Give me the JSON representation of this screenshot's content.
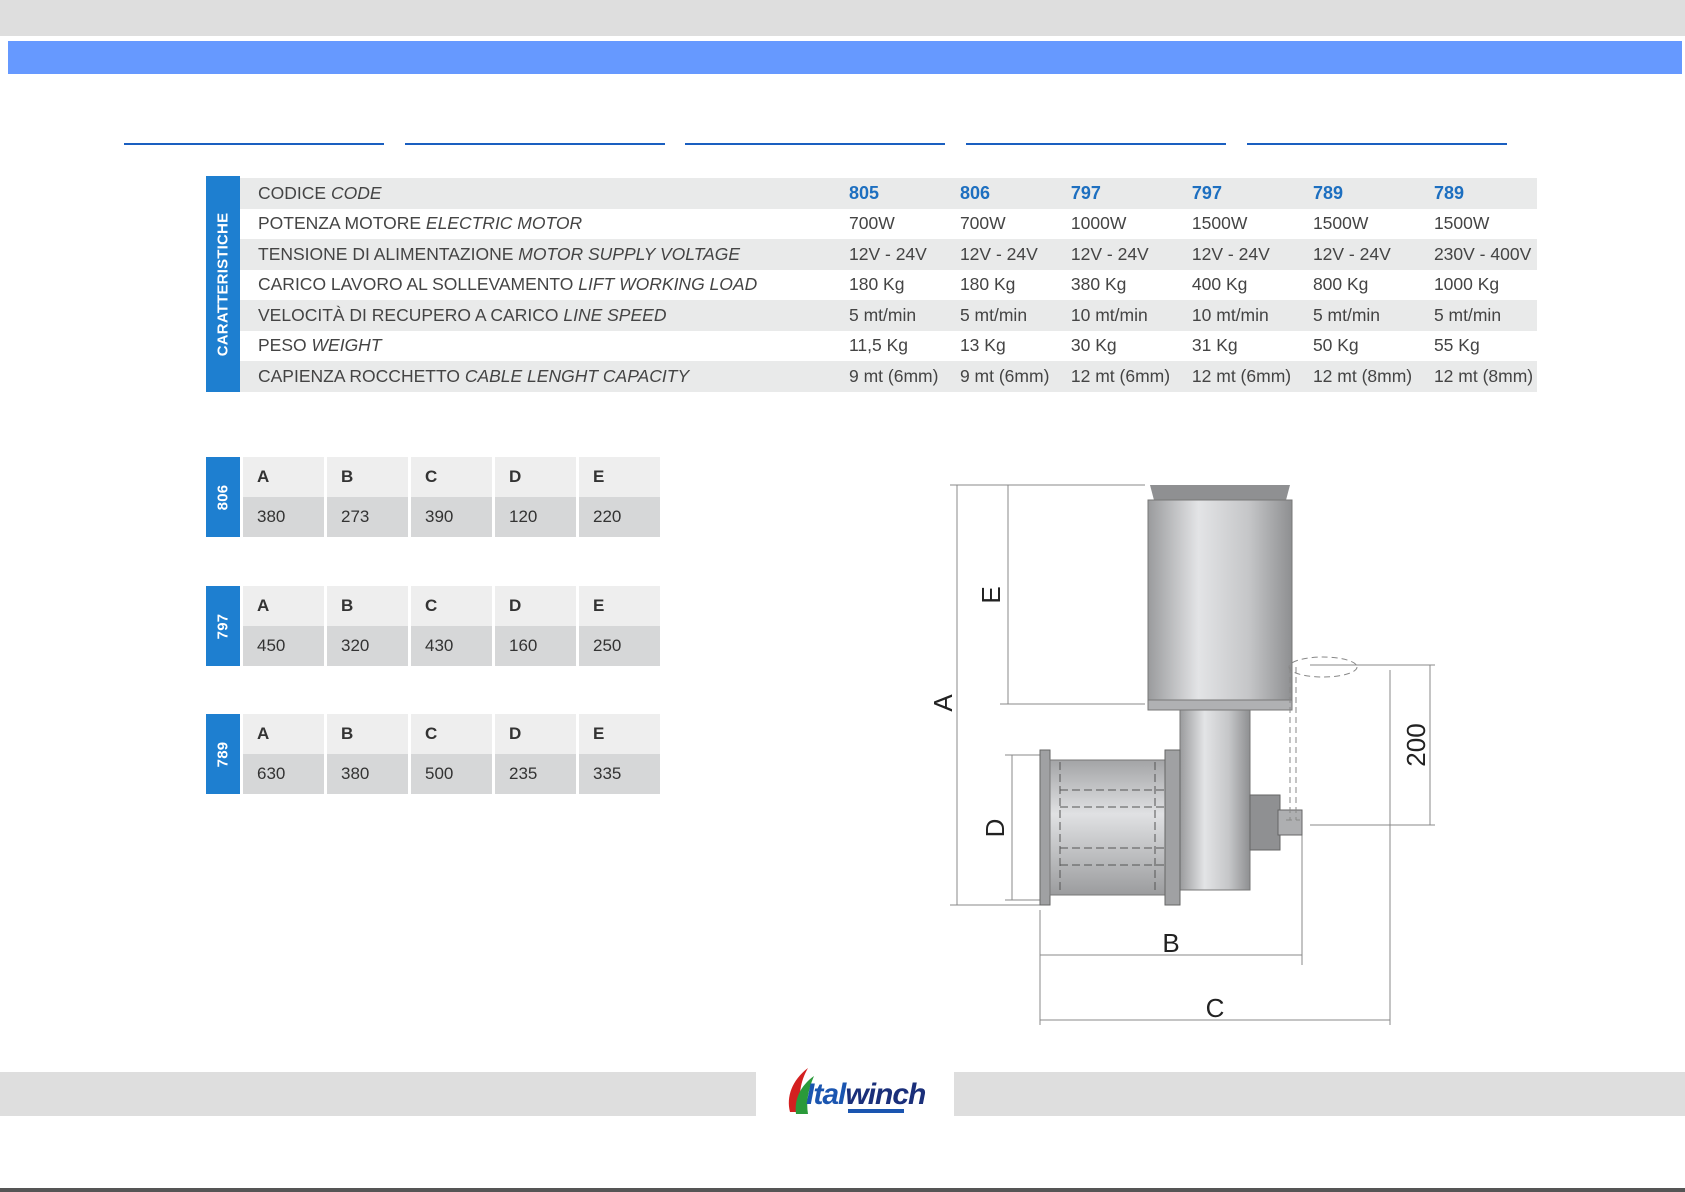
{
  "spec": {
    "side_label": "CARATTERISTICHE",
    "rows": [
      {
        "it": "CODICE",
        "en": "CODE",
        "values": [
          "805",
          "806",
          "797",
          "797",
          "789",
          "789"
        ],
        "is_code": true
      },
      {
        "it": "POTENZA MOTORE",
        "en": "ELECTRIC MOTOR",
        "values": [
          "700W",
          "700W",
          "1000W",
          "1500W",
          "1500W",
          "1500W"
        ]
      },
      {
        "it": "TENSIONE DI ALIMENTAZIONE",
        "en": "MOTOR SUPPLY VOLTAGE",
        "values": [
          "12V - 24V",
          "12V - 24V",
          "12V - 24V",
          "12V - 24V",
          "12V - 24V",
          "230V - 400V"
        ]
      },
      {
        "it": "CARICO LAVORO AL SOLLEVAMENTO",
        "en": "LIFT WORKING LOAD",
        "values": [
          "180 Kg",
          "180 Kg",
          "380 Kg",
          "400 Kg",
          "800 Kg",
          "1000 Kg"
        ]
      },
      {
        "it": "VELOCITÀ DI RECUPERO A CARICO",
        "en": "LINE SPEED",
        "values": [
          "5 mt/min",
          "5 mt/min",
          "10 mt/min",
          "10 mt/min",
          "5 mt/min",
          "5 mt/min"
        ]
      },
      {
        "it": "PESO",
        "en": "WEIGHT",
        "values": [
          "11,5 Kg",
          "13 Kg",
          "30 Kg",
          "31 Kg",
          "50 Kg",
          "55 Kg"
        ]
      },
      {
        "it": "CAPIENZA ROCCHETTO",
        "en": "CABLE LENGHT CAPACITY",
        "values": [
          "9 mt (6mm)",
          "9 mt (6mm)",
          "12 mt (6mm)",
          "12 mt (6mm)",
          "12 mt (8mm)",
          "12 mt (8mm)"
        ]
      }
    ]
  },
  "dimension_tables": [
    {
      "model": "806",
      "headers": [
        "A",
        "B",
        "C",
        "D",
        "E"
      ],
      "values": [
        "380",
        "273",
        "390",
        "120",
        "220"
      ]
    },
    {
      "model": "797",
      "headers": [
        "A",
        "B",
        "C",
        "D",
        "E"
      ],
      "values": [
        "450",
        "320",
        "430",
        "160",
        "250"
      ]
    },
    {
      "model": "789",
      "headers": [
        "A",
        "B",
        "C",
        "D",
        "E"
      ],
      "values": [
        "630",
        "380",
        "500",
        "235",
        "335"
      ]
    }
  ],
  "drawing": {
    "labels": {
      "A": "A",
      "B": "B",
      "C": "C",
      "D": "D",
      "E": "E",
      "height": "200"
    }
  },
  "logo": {
    "text_ital": "Ital",
    "text_winch": "winch"
  },
  "colors": {
    "accent_blue": "#1e7fd0",
    "band_blue": "#6699ff",
    "code_blue": "#1d6fc0",
    "logo_red": "#d42020",
    "logo_green": "#2a9a3a"
  }
}
